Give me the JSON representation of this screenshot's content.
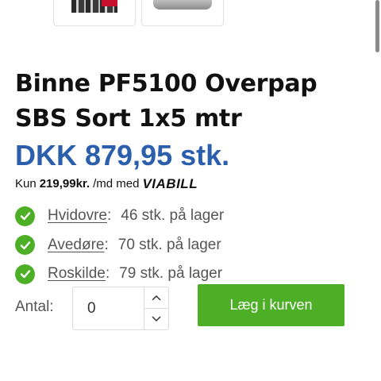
{
  "product": {
    "title": "Binne PF5100 Overpap SBS Sort 1x5 mtr",
    "price": "DKK 879,95 stk."
  },
  "installment": {
    "prefix": "Kun",
    "amount": "219,99kr.",
    "suffix": "/md med",
    "provider": "VIABILL"
  },
  "stock": [
    {
      "store": "Hvidovre",
      "count": "46 stk. på lager"
    },
    {
      "store": "Avedøre",
      "count": "70 stk. på lager"
    },
    {
      "store": "Roskilde",
      "count": "79 stk. på lager"
    }
  ],
  "quantity": {
    "label": "Antal:",
    "value": "0"
  },
  "add_to_cart": {
    "label": "Læg i kurven"
  },
  "colors": {
    "price": "#2b5fab",
    "accent_green": "#4caf25"
  }
}
